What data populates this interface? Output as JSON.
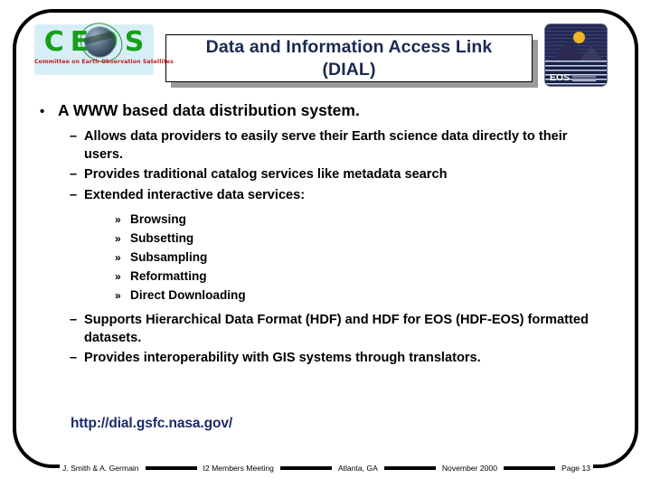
{
  "logos": {
    "ceos": {
      "letters": "CEOS",
      "tagline": "Committee on Earth Observation Satellites",
      "letters_color": "#17a01a",
      "tagline_color": "#c21f24"
    },
    "eos": {
      "label": "EOS",
      "background_color": "#1a1d3a",
      "sun_color": "#f0b429"
    }
  },
  "title": {
    "line1": "Data and Information Access Link",
    "line2": "(DIAL)",
    "full": "Data and Information Access Link (DIAL)",
    "text_color": "#1b2a52",
    "shadow_color": "#9a9a9a"
  },
  "bullets": {
    "level1_marker": "•",
    "level2_marker": "–",
    "level3_marker": "»",
    "main": "A WWW based data distribution system.",
    "sub": [
      "Allows data providers to easily serve their Earth science data directly to their users.",
      "Provides traditional catalog services like metadata search",
      "Extended interactive data services:"
    ],
    "services": [
      "Browsing",
      "Subsetting",
      "Subsampling",
      "Reformatting",
      "Direct Downloading"
    ],
    "sub_after": [
      "Supports Hierarchical Data Format (HDF) and HDF for EOS (HDF-EOS) formatted datasets.",
      "Provides interoperability with GIS systems through translators."
    ]
  },
  "url": {
    "text": "http://dial.gsfc.nasa.gov/",
    "color": "#1b2a6b"
  },
  "footer": {
    "authors": "J. Smith & A. Germain",
    "event": "I2 Members Meeting",
    "location": "Atlanta, GA",
    "date": "November 2000",
    "page": "Page 13"
  }
}
